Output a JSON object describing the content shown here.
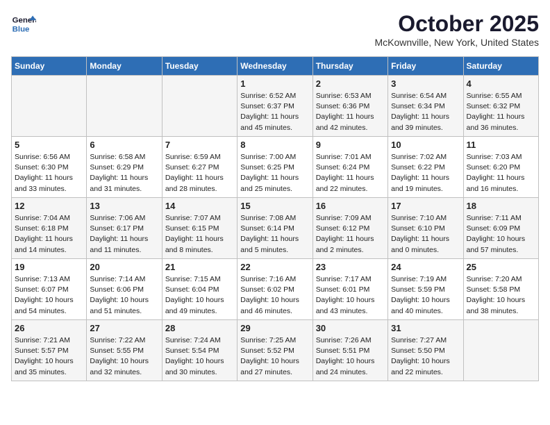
{
  "header": {
    "logo_general": "General",
    "logo_blue": "Blue",
    "month": "October 2025",
    "location": "McKownville, New York, United States"
  },
  "weekdays": [
    "Sunday",
    "Monday",
    "Tuesday",
    "Wednesday",
    "Thursday",
    "Friday",
    "Saturday"
  ],
  "weeks": [
    [
      {
        "day": "",
        "info": ""
      },
      {
        "day": "",
        "info": ""
      },
      {
        "day": "",
        "info": ""
      },
      {
        "day": "1",
        "info": "Sunrise: 6:52 AM\nSunset: 6:37 PM\nDaylight: 11 hours\nand 45 minutes."
      },
      {
        "day": "2",
        "info": "Sunrise: 6:53 AM\nSunset: 6:36 PM\nDaylight: 11 hours\nand 42 minutes."
      },
      {
        "day": "3",
        "info": "Sunrise: 6:54 AM\nSunset: 6:34 PM\nDaylight: 11 hours\nand 39 minutes."
      },
      {
        "day": "4",
        "info": "Sunrise: 6:55 AM\nSunset: 6:32 PM\nDaylight: 11 hours\nand 36 minutes."
      }
    ],
    [
      {
        "day": "5",
        "info": "Sunrise: 6:56 AM\nSunset: 6:30 PM\nDaylight: 11 hours\nand 33 minutes."
      },
      {
        "day": "6",
        "info": "Sunrise: 6:58 AM\nSunset: 6:29 PM\nDaylight: 11 hours\nand 31 minutes."
      },
      {
        "day": "7",
        "info": "Sunrise: 6:59 AM\nSunset: 6:27 PM\nDaylight: 11 hours\nand 28 minutes."
      },
      {
        "day": "8",
        "info": "Sunrise: 7:00 AM\nSunset: 6:25 PM\nDaylight: 11 hours\nand 25 minutes."
      },
      {
        "day": "9",
        "info": "Sunrise: 7:01 AM\nSunset: 6:24 PM\nDaylight: 11 hours\nand 22 minutes."
      },
      {
        "day": "10",
        "info": "Sunrise: 7:02 AM\nSunset: 6:22 PM\nDaylight: 11 hours\nand 19 minutes."
      },
      {
        "day": "11",
        "info": "Sunrise: 7:03 AM\nSunset: 6:20 PM\nDaylight: 11 hours\nand 16 minutes."
      }
    ],
    [
      {
        "day": "12",
        "info": "Sunrise: 7:04 AM\nSunset: 6:18 PM\nDaylight: 11 hours\nand 14 minutes."
      },
      {
        "day": "13",
        "info": "Sunrise: 7:06 AM\nSunset: 6:17 PM\nDaylight: 11 hours\nand 11 minutes."
      },
      {
        "day": "14",
        "info": "Sunrise: 7:07 AM\nSunset: 6:15 PM\nDaylight: 11 hours\nand 8 minutes."
      },
      {
        "day": "15",
        "info": "Sunrise: 7:08 AM\nSunset: 6:14 PM\nDaylight: 11 hours\nand 5 minutes."
      },
      {
        "day": "16",
        "info": "Sunrise: 7:09 AM\nSunset: 6:12 PM\nDaylight: 11 hours\nand 2 minutes."
      },
      {
        "day": "17",
        "info": "Sunrise: 7:10 AM\nSunset: 6:10 PM\nDaylight: 11 hours\nand 0 minutes."
      },
      {
        "day": "18",
        "info": "Sunrise: 7:11 AM\nSunset: 6:09 PM\nDaylight: 10 hours\nand 57 minutes."
      }
    ],
    [
      {
        "day": "19",
        "info": "Sunrise: 7:13 AM\nSunset: 6:07 PM\nDaylight: 10 hours\nand 54 minutes."
      },
      {
        "day": "20",
        "info": "Sunrise: 7:14 AM\nSunset: 6:06 PM\nDaylight: 10 hours\nand 51 minutes."
      },
      {
        "day": "21",
        "info": "Sunrise: 7:15 AM\nSunset: 6:04 PM\nDaylight: 10 hours\nand 49 minutes."
      },
      {
        "day": "22",
        "info": "Sunrise: 7:16 AM\nSunset: 6:02 PM\nDaylight: 10 hours\nand 46 minutes."
      },
      {
        "day": "23",
        "info": "Sunrise: 7:17 AM\nSunset: 6:01 PM\nDaylight: 10 hours\nand 43 minutes."
      },
      {
        "day": "24",
        "info": "Sunrise: 7:19 AM\nSunset: 5:59 PM\nDaylight: 10 hours\nand 40 minutes."
      },
      {
        "day": "25",
        "info": "Sunrise: 7:20 AM\nSunset: 5:58 PM\nDaylight: 10 hours\nand 38 minutes."
      }
    ],
    [
      {
        "day": "26",
        "info": "Sunrise: 7:21 AM\nSunset: 5:57 PM\nDaylight: 10 hours\nand 35 minutes."
      },
      {
        "day": "27",
        "info": "Sunrise: 7:22 AM\nSunset: 5:55 PM\nDaylight: 10 hours\nand 32 minutes."
      },
      {
        "day": "28",
        "info": "Sunrise: 7:24 AM\nSunset: 5:54 PM\nDaylight: 10 hours\nand 30 minutes."
      },
      {
        "day": "29",
        "info": "Sunrise: 7:25 AM\nSunset: 5:52 PM\nDaylight: 10 hours\nand 27 minutes."
      },
      {
        "day": "30",
        "info": "Sunrise: 7:26 AM\nSunset: 5:51 PM\nDaylight: 10 hours\nand 24 minutes."
      },
      {
        "day": "31",
        "info": "Sunrise: 7:27 AM\nSunset: 5:50 PM\nDaylight: 10 hours\nand 22 minutes."
      },
      {
        "day": "",
        "info": ""
      }
    ]
  ]
}
